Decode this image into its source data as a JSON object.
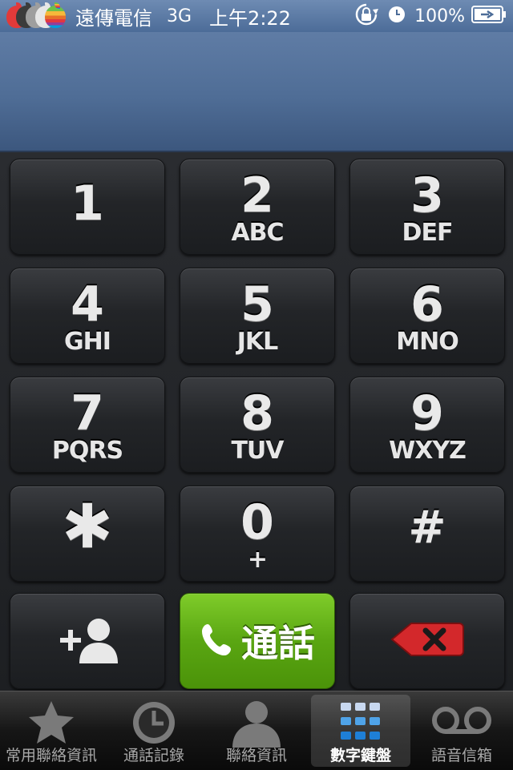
{
  "status_bar": {
    "carrier": "遠傳電信",
    "network": "3G",
    "time": "上午2:22",
    "battery": "100%",
    "icons": [
      "rotation-lock-icon",
      "alarm-clock-icon",
      "battery-charging-icon"
    ]
  },
  "display": {
    "number": ""
  },
  "keypad": {
    "keys": [
      {
        "digit": "1",
        "letters": ""
      },
      {
        "digit": "2",
        "letters": "ABC"
      },
      {
        "digit": "3",
        "letters": "DEF"
      },
      {
        "digit": "4",
        "letters": "GHI"
      },
      {
        "digit": "5",
        "letters": "JKL"
      },
      {
        "digit": "6",
        "letters": "MNO"
      },
      {
        "digit": "7",
        "letters": "PQRS"
      },
      {
        "digit": "8",
        "letters": "TUV"
      },
      {
        "digit": "9",
        "letters": "WXYZ"
      },
      {
        "digit": "✱",
        "letters": ""
      },
      {
        "digit": "0",
        "letters": "+"
      },
      {
        "digit": "#",
        "letters": ""
      }
    ],
    "add_contact_icon": "add-contact-icon",
    "call_label": "通話",
    "delete_icon": "backspace-icon",
    "colors": {
      "call_green": "#5aa612",
      "delete_red": "#d3282b"
    }
  },
  "tab_bar": {
    "tabs": [
      {
        "label": "常用聯絡資訊",
        "icon": "star-icon"
      },
      {
        "label": "通話記錄",
        "icon": "clock-icon"
      },
      {
        "label": "聯絡資訊",
        "icon": "person-icon"
      },
      {
        "label": "數字鍵盤",
        "icon": "keypad-icon",
        "active": true
      },
      {
        "label": "語音信箱",
        "icon": "voicemail-icon"
      }
    ]
  }
}
